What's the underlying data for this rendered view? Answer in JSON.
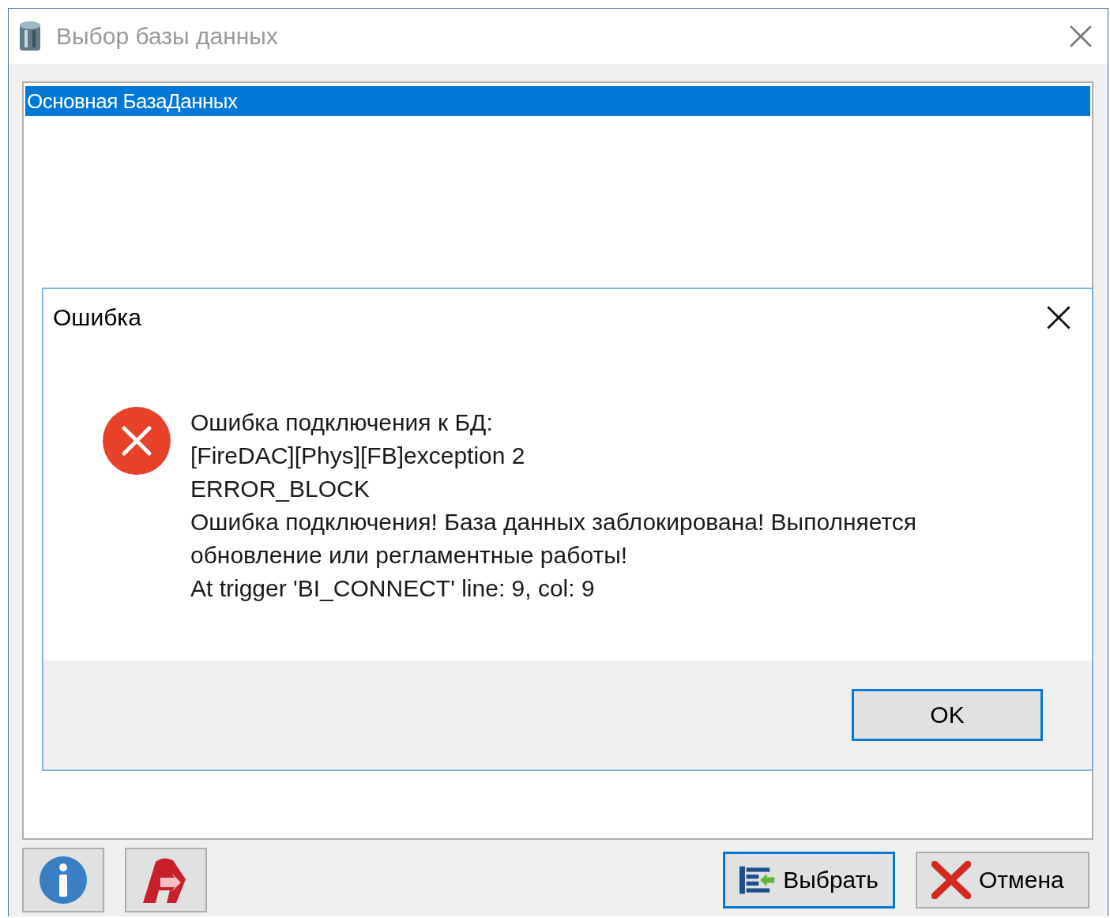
{
  "window": {
    "title": "Выбор базы данных"
  },
  "databases": [
    {
      "name": "Основная БазаДанных",
      "selected": true
    }
  ],
  "error_dialog": {
    "title": "Ошибка",
    "message": [
      "Ошибка подключения к БД:",
      "[FireDAC][Phys][FB]exception 2",
      "ERROR_BLOCK",
      "Ошибка подключения! База данных заблокирована! Выполняется обновление или регламентные работы!",
      "At trigger 'BI_CONNECT' line: 9, col: 9"
    ],
    "button": "OK"
  },
  "buttons": [
    {
      "kind": "info"
    },
    {
      "kind": "logo"
    },
    {
      "kind": "select",
      "label": "Выбрать",
      "focused": true
    },
    {
      "kind": "cancel",
      "label": "Отмена",
      "focused": false
    }
  ]
}
